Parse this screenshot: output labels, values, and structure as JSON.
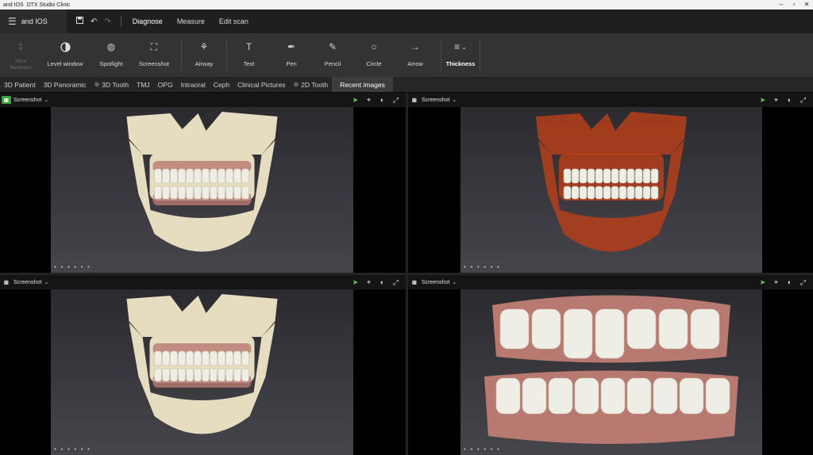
{
  "titlebar": {
    "title": "and IOS  DTX Studio Clinic",
    "minimize": "–",
    "restore": "▫",
    "close": "✕"
  },
  "menubar": {
    "menu_icon": "hamburger-menu-icon",
    "project_name": "and IOS",
    "quick_actions": {
      "save": "save-icon",
      "undo": "undo-icon",
      "redo": "redo-icon"
    },
    "tabs": [
      {
        "label": "Diagnose",
        "active": true
      },
      {
        "label": "Measure",
        "active": false
      },
      {
        "label": "Edit scan",
        "active": false
      }
    ]
  },
  "toolbar": {
    "tools": [
      {
        "label": "Slice thickness",
        "icon": "slice-thickness-icon",
        "disabled": true
      },
      {
        "label": "Level window",
        "icon": "level-window-icon"
      },
      {
        "label": "Spotlight",
        "icon": "spotlight-icon"
      },
      {
        "label": "Screenshot",
        "icon": "screenshot-icon"
      },
      {
        "label": "Airway",
        "icon": "airway-icon"
      },
      {
        "label": "Text",
        "icon": "text-icon"
      },
      {
        "label": "Pen",
        "icon": "pen-icon"
      },
      {
        "label": "Pencil",
        "icon": "pencil-icon"
      },
      {
        "label": "Circle",
        "icon": "circle-icon"
      },
      {
        "label": "Arrow",
        "icon": "arrow-icon"
      },
      {
        "label": "Thickness",
        "icon": "thickness-icon"
      }
    ]
  },
  "subtabs": [
    {
      "label": "3D Patient"
    },
    {
      "label": "3D Panoramic"
    },
    {
      "label": "3D Tooth",
      "prefix_icon": "plus-circle-icon"
    },
    {
      "label": "TMJ"
    },
    {
      "label": "OPG"
    },
    {
      "label": "Intraoral"
    },
    {
      "label": "Ceph"
    },
    {
      "label": "Clinical Pictures"
    },
    {
      "label": "2D Tooth",
      "prefix_icon": "plus-circle-icon"
    },
    {
      "label": "Recent images",
      "active": true
    }
  ],
  "viewports": [
    {
      "id": "top-left",
      "screenshot_label": "Screenshot",
      "camera_active": true,
      "render": "bone"
    },
    {
      "id": "top-right",
      "screenshot_label": "Screenshot",
      "camera_active": false,
      "render": "soft-tissue"
    },
    {
      "id": "bottom-left",
      "screenshot_label": "Screenshot",
      "camera_active": false,
      "render": "bone"
    },
    {
      "id": "bottom-right",
      "screenshot_label": "Screenshot",
      "camera_active": false,
      "render": "intraoral-scan"
    }
  ],
  "colors": {
    "accent_green": "#3ba33b",
    "bone": "#e6dcc0",
    "soft_tissue": "#b5401a",
    "gum": "#b87a70",
    "tooth": "#efeee6"
  }
}
